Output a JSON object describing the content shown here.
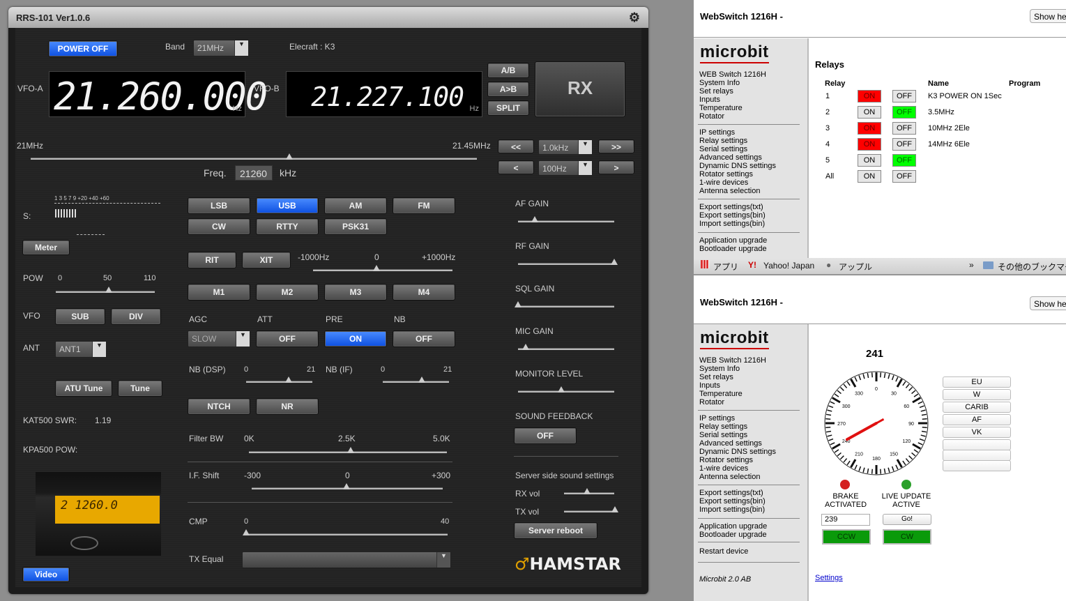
{
  "rrs": {
    "title": "RRS-101 Ver1.0.6",
    "power_label": "POWER OFF",
    "band_label": "Band",
    "band_value": "21MHz",
    "radio_model": "Elecraft : K3",
    "vfo_a_label": "VFO-A",
    "vfo_a_freq": "21.260.000",
    "vfo_b_label": "VFO-B",
    "vfo_b_freq": "21.227.100",
    "hz": "Hz",
    "ab": "A/B",
    "a_to_b": "A>B",
    "split": "SPLIT",
    "rx": "RX",
    "scale_min": "21MHz",
    "scale_max": "21.45MHz",
    "freq_label": "Freq.",
    "freq_value": "21260",
    "khz": "kHz",
    "fast_down": "<<",
    "fast_up": ">>",
    "step_down": "<",
    "step_up": ">",
    "step_coarse": "1.0kHz",
    "step_fine": "100Hz",
    "s_label": "S:",
    "s_scale": "1  3  5  7  9    +20  +40  +60",
    "meter": "Meter",
    "pow_label": "POW",
    "pow_min": "0",
    "pow_mid": "50",
    "pow_max": "110",
    "vfo_label": "VFO",
    "sub": "SUB",
    "div": "DIV",
    "ant_label": "ANT",
    "ant_value": "ANT1",
    "atu_tune": "ATU Tune",
    "tune": "Tune",
    "kat_label": "KAT500 SWR:",
    "kat_value": "1.19",
    "kpa_label": "KPA500 POW:",
    "video": "Video",
    "modes": [
      "LSB",
      "USB",
      "AM",
      "FM",
      "CW",
      "RTTY",
      "PSK31"
    ],
    "active_mode": "USB",
    "rit": "RIT",
    "xit": "XIT",
    "rit_min": "-1000Hz",
    "rit_mid": "0",
    "rit_max": "+1000Hz",
    "memories": [
      "M1",
      "M2",
      "M3",
      "M4"
    ],
    "agc_label": "AGC",
    "agc_value": "SLOW",
    "att_label": "ATT",
    "att_value": "OFF",
    "pre_label": "PRE",
    "pre_value": "ON",
    "nb_label": "NB",
    "nb_value": "OFF",
    "nb_dsp_label": "NB (DSP)",
    "nb_dsp_min": "0",
    "nb_dsp_max": "21",
    "nb_if_label": "NB (IF)",
    "nb_if_min": "0",
    "nb_if_max": "21",
    "ntch": "NTCH",
    "nr": "NR",
    "filter_label": "Filter BW",
    "filter_min": "0K",
    "filter_mid": "2.5K",
    "filter_max": "5.0K",
    "ifshift_label": "I.F. Shift",
    "ifshift_min": "-300",
    "ifshift_mid": "0",
    "ifshift_max": "+300",
    "cmp_label": "CMP",
    "cmp_min": "0",
    "cmp_max": "40",
    "txeq_label": "TX Equal",
    "af_gain": "AF GAIN",
    "rf_gain": "RF GAIN",
    "sql_gain": "SQL GAIN",
    "mic_gain": "MIC GAIN",
    "monitor": "MONITOR LEVEL",
    "sound_fb": "SOUND FEEDBACK",
    "sound_fb_value": "OFF",
    "server_sound": "Server side sound settings",
    "rx_vol": "RX vol",
    "tx_vol": "TX vol",
    "server_reboot": "Server reboot",
    "brand": "HAMSTAR",
    "video_lcd": "2 1260.0"
  },
  "ws_top": {
    "title": "WebSwitch 1216H -",
    "show": "Show he",
    "logo": "microbit",
    "menu1": [
      "WEB Switch 1216H",
      "System Info",
      "Set relays",
      "Inputs",
      "Temperature",
      "Rotator"
    ],
    "menu2": [
      "IP settings",
      "Relay settings",
      "Serial settings",
      "Advanced settings",
      "Dynamic DNS settings",
      "Rotator settings",
      "1-wire devices",
      "Antenna selection"
    ],
    "menu3": [
      "Export settings(txt)",
      "Export settings(bin)",
      "Import settings(bin)"
    ],
    "menu4": [
      "Application upgrade",
      "Bootloader upgrade"
    ],
    "heading": "Relays",
    "col_relay": "Relay",
    "col_name": "Name",
    "col_program": "Program",
    "on": "ON",
    "off": "OFF",
    "rows": [
      {
        "relay": "1",
        "name": "K3 POWER ON 1Sec",
        "state": "on"
      },
      {
        "relay": "2",
        "name": "3.5MHz",
        "state": "off"
      },
      {
        "relay": "3",
        "name": "10MHz 2Ele",
        "state": "on"
      },
      {
        "relay": "4",
        "name": "14MHz 6Ele",
        "state": "on"
      },
      {
        "relay": "5",
        "name": "",
        "state": "off"
      },
      {
        "relay": "All",
        "name": "",
        "state": "none"
      }
    ]
  },
  "bookmarks": {
    "apps": "アプリ",
    "yahoo": "Yahoo! Japan",
    "apple": "アップル",
    "more": "»",
    "other": "その他のブックマー"
  },
  "ws_bottom": {
    "title": "WebSwitch 1216H -",
    "show": "Show he",
    "logo": "microbit",
    "menu1": [
      "WEB Switch 1216H",
      "System Info",
      "Set relays",
      "Inputs",
      "Temperature",
      "Rotator"
    ],
    "menu2": [
      "IP settings",
      "Relay settings",
      "Serial settings",
      "Advanced settings",
      "Dynamic DNS settings",
      "Rotator settings",
      "1-wire devices",
      "Antenna selection"
    ],
    "menu3": [
      "Export settings(txt)",
      "Export settings(bin)",
      "Import settings(bin)"
    ],
    "menu4": [
      "Application upgrade",
      "Bootloader upgrade"
    ],
    "menu5": "Restart device",
    "footer": "Microbit 2.0 AB",
    "bearing": "241",
    "brake_label1": "BRAKE",
    "brake_label2": "ACTIVATED",
    "live_label1": "LIVE UPDATE",
    "live_label2": "ACTIVE",
    "target_value": "239",
    "go": "Go!",
    "ccw": "CCW",
    "cw": "CW",
    "locations": [
      "EU",
      "W",
      "CARIB",
      "AF",
      "VK",
      "",
      "",
      ""
    ],
    "settings_link": "Settings",
    "compass_labels": [
      "0",
      "30",
      "60",
      "90",
      "120",
      "150",
      "180",
      "210",
      "240",
      "270",
      "300",
      "330"
    ]
  }
}
